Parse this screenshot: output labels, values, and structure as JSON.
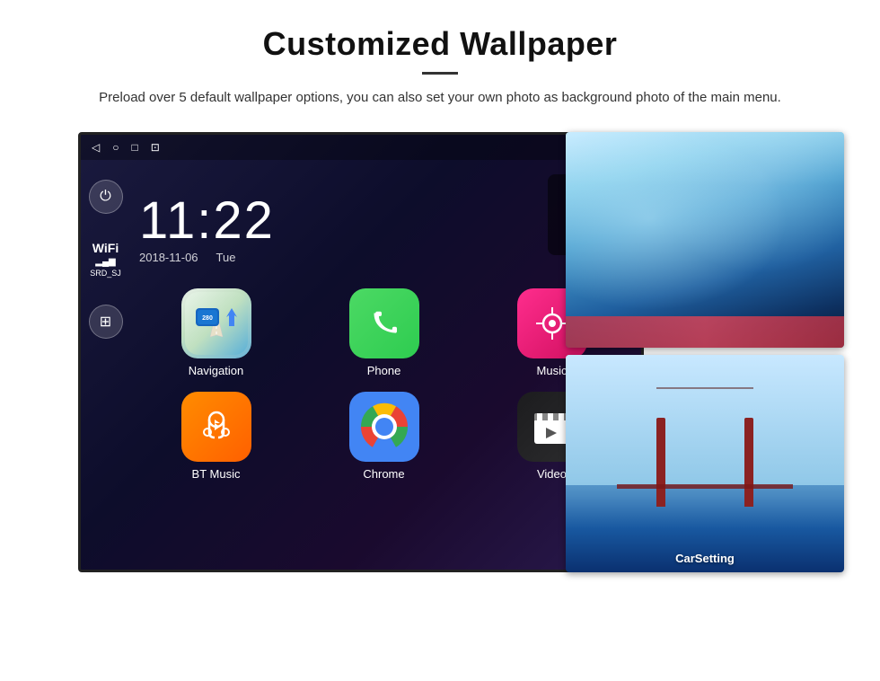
{
  "header": {
    "title": "Customized Wallpaper",
    "description": "Preload over 5 default wallpaper options, you can also set your own photo as background photo of the main menu."
  },
  "statusBar": {
    "time": "11:22",
    "navIcon": "◁",
    "homeIcon": "○",
    "recentIcon": "□",
    "screenshotIcon": "⊡"
  },
  "clock": {
    "time": "11:22",
    "date": "2018-11-06",
    "day": "Tue"
  },
  "wifi": {
    "label": "WiFi",
    "ssid": "SRD_SJ"
  },
  "apps": [
    {
      "id": "navigation",
      "label": "Navigation",
      "type": "navigation"
    },
    {
      "id": "phone",
      "label": "Phone",
      "type": "phone"
    },
    {
      "id": "music",
      "label": "Music",
      "type": "music"
    },
    {
      "id": "btmusic",
      "label": "BT Music",
      "type": "btmusic"
    },
    {
      "id": "chrome",
      "label": "Chrome",
      "type": "chrome"
    },
    {
      "id": "video",
      "label": "Video",
      "type": "video"
    }
  ],
  "wallpapers": {
    "carsetting_label": "CarSetting"
  },
  "buttons": {
    "power": "⏻",
    "apps": "⊞"
  }
}
